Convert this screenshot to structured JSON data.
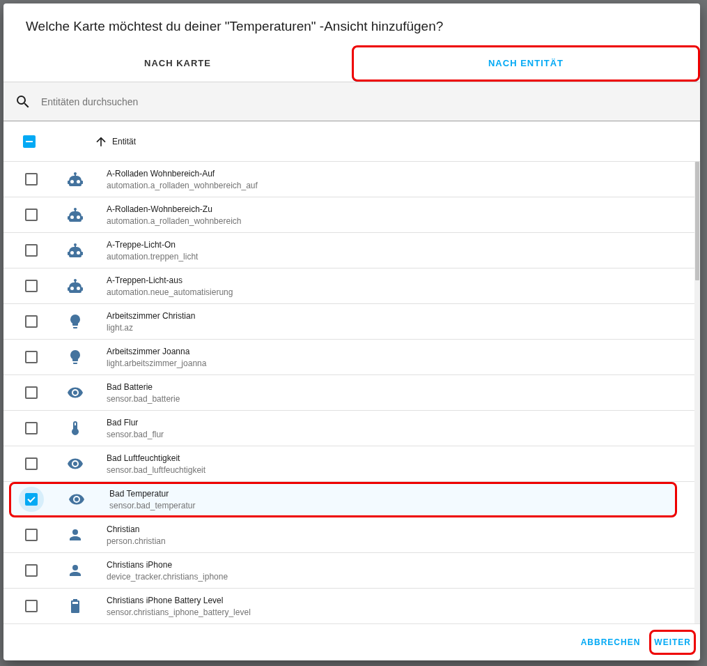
{
  "dialog": {
    "title": "Welche Karte möchtest du deiner \"Temperaturen\" -Ansicht hinzufügen?"
  },
  "tabs": [
    {
      "label": "NACH KARTE",
      "selected": false,
      "highlighted": false
    },
    {
      "label": "NACH ENTITÄT",
      "selected": true,
      "highlighted": true
    }
  ],
  "search": {
    "placeholder": "Entitäten durchsuchen"
  },
  "table": {
    "select_all": {
      "indeterminate": true
    },
    "column": "Entität",
    "rows": [
      {
        "kind": "automation",
        "name": "A-Rolladen Wohnbereich-Auf",
        "entity_id": "automation.a_rolladen_wohnbereich_auf",
        "checked": false,
        "highlighted": false
      },
      {
        "kind": "automation",
        "name": "A-Rolladen-Wohnbereich-Zu",
        "entity_id": "automation.a_rolladen_wohnbereich",
        "checked": false,
        "highlighted": false
      },
      {
        "kind": "automation",
        "name": "A-Treppe-Licht-On",
        "entity_id": "automation.treppen_licht",
        "checked": false,
        "highlighted": false
      },
      {
        "kind": "automation",
        "name": "A-Treppen-Licht-aus",
        "entity_id": "automation.neue_automatisierung",
        "checked": false,
        "highlighted": false
      },
      {
        "kind": "light",
        "name": "Arbeitszimmer Christian",
        "entity_id": "light.az",
        "checked": false,
        "highlighted": false
      },
      {
        "kind": "light",
        "name": "Arbeitszimmer Joanna",
        "entity_id": "light.arbeitszimmer_joanna",
        "checked": false,
        "highlighted": false
      },
      {
        "kind": "sensor",
        "name": "Bad Batterie",
        "entity_id": "sensor.bad_batterie",
        "checked": false,
        "highlighted": false
      },
      {
        "kind": "temperature",
        "name": "Bad Flur",
        "entity_id": "sensor.bad_flur",
        "checked": false,
        "highlighted": false
      },
      {
        "kind": "sensor",
        "name": "Bad Luftfeuchtigkeit",
        "entity_id": "sensor.bad_luftfeuchtigkeit",
        "checked": false,
        "highlighted": false
      },
      {
        "kind": "sensor",
        "name": "Bad Temperatur",
        "entity_id": "sensor.bad_temperatur",
        "checked": true,
        "highlighted": true
      },
      {
        "kind": "person",
        "name": "Christian",
        "entity_id": "person.christian",
        "checked": false,
        "highlighted": false
      },
      {
        "kind": "person",
        "name": "Christians iPhone",
        "entity_id": "device_tracker.christians_iphone",
        "checked": false,
        "highlighted": false
      },
      {
        "kind": "battery",
        "name": "Christians iPhone Battery Level",
        "entity_id": "sensor.christians_iphone_battery_level",
        "checked": false,
        "highlighted": false
      }
    ]
  },
  "buttons": [
    {
      "label": "ABBRECHEN",
      "highlighted": false
    },
    {
      "label": "WEITER",
      "highlighted": true
    }
  ]
}
